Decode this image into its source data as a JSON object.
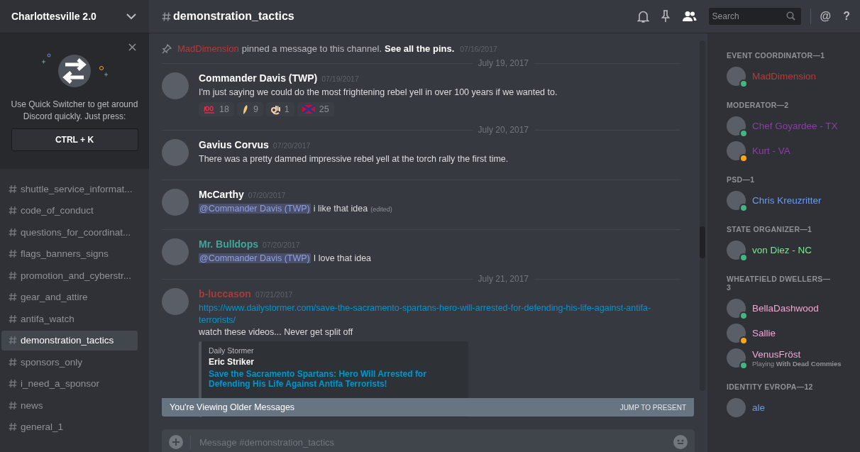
{
  "server": {
    "name": "Charlottesville 2.0"
  },
  "quick_switcher": {
    "text": "Use Quick Switcher to get around Discord quickly. Just press:",
    "shortcut": "CTRL + K"
  },
  "channels": [
    {
      "name": "shuttle_service_informat...",
      "selected": false
    },
    {
      "name": "code_of_conduct",
      "selected": false
    },
    {
      "name": "questions_for_coordinat...",
      "selected": false
    },
    {
      "name": "flags_banners_signs",
      "selected": false
    },
    {
      "name": "promotion_and_cyberstr...",
      "selected": false
    },
    {
      "name": "gear_and_attire",
      "selected": false
    },
    {
      "name": "antifa_watch",
      "selected": false
    },
    {
      "name": "demonstration_tactics",
      "selected": true
    },
    {
      "name": "sponsors_only",
      "selected": false
    },
    {
      "name": "i_need_a_sponsor",
      "selected": false
    },
    {
      "name": "news",
      "selected": false
    },
    {
      "name": "general_1",
      "selected": false
    }
  ],
  "header": {
    "channel": "demonstration_tactics",
    "search_placeholder": "Search",
    "mention_symbol": "@",
    "help_symbol": "?"
  },
  "pin_notice": {
    "author": "MadDimension",
    "color": "#b83a36",
    "text": "pinned a message to this channel.",
    "link": "See all the pins.",
    "time": "07/16/2017"
  },
  "messages": [
    {
      "date": "July 19, 2017",
      "author": "Commander Davis (TWP)",
      "color": "#ffffff",
      "time": "07/19/2017",
      "text": "I'm just saying we could do the most frightening rebel yell in over 100 years if we wanted to.",
      "reactions": [
        {
          "kind": "hundred",
          "count": "18"
        },
        {
          "kind": "crescent",
          "count": "9"
        },
        {
          "kind": "ok_hand",
          "count": "1"
        },
        {
          "kind": "flag",
          "count": "25"
        }
      ]
    },
    {
      "date": "July 20, 2017",
      "author": "Gavius Corvus",
      "color": "#ffffff",
      "time": "07/20/2017",
      "text": "There was a pretty damned impressive rebel yell at the torch rally the first time."
    },
    {
      "author": "McCarthy",
      "color": "#ffffff",
      "time": "07/20/2017",
      "mention": "@Commander Davis (TWP)",
      "text": "i like that idea",
      "edited": "(edited)"
    },
    {
      "author": "Mr. Bulldops",
      "color": "#3fa79a",
      "time": "07/20/2017",
      "mention": "@Commander Davis (TWP)",
      "text": "I love that idea"
    },
    {
      "date": "July 21, 2017",
      "author": "b-luccason",
      "color": "#a53c3c",
      "time": "07/21/2017",
      "link": "https://www.dailystormer.com/save-the-sacramento-spartans-hero-will-arrested-for-defending-his-life-against-antifa-terrorists/",
      "text": "watch these videos... Never get split off",
      "embed": {
        "provider": "Daily Stormer",
        "author": "Eric Striker",
        "title": "Save the Sacramento Spartans: Hero Will Arrested for Defending His Life Against Antifa Terrorists!"
      }
    }
  ],
  "older_bar": {
    "text": "You're Viewing Older Messages",
    "button": "JUMP TO PRESENT"
  },
  "composer": {
    "placeholder": "Message #demonstration_tactics"
  },
  "member_groups": [
    {
      "title": "EVENT COORDINATOR—1",
      "members": [
        {
          "name": "MadDimension",
          "color": "#b83a36",
          "status": {
            "color": "#43b581"
          }
        }
      ]
    },
    {
      "title": "MODERATOR—2",
      "members": [
        {
          "name": "Chef Goyardee - TX",
          "color": "#8a3fa3",
          "status": {
            "color": "#43b581"
          }
        },
        {
          "name": "Kurt - VA",
          "color": "#8a3fa3",
          "status": {
            "color": "#faa61a"
          }
        }
      ]
    },
    {
      "title": "PSD—1",
      "members": [
        {
          "name": "Chris Kreuzritter",
          "color": "#6a9cf0",
          "status": {
            "color": "#43b581"
          }
        }
      ]
    },
    {
      "title": "STATE ORGANIZER—1",
      "members": [
        {
          "name": "von Diez - NC",
          "color": "#7ce88f",
          "status": {
            "color": "#43b581"
          }
        }
      ]
    },
    {
      "title": "WHEATFIELD DWELLERS—3",
      "members": [
        {
          "name": "BellaDashwood",
          "color": "#f4a6d7",
          "status": {
            "color": "#43b581"
          }
        },
        {
          "name": "Sallie",
          "color": "#f4a6d7",
          "status": {
            "color": "#faa61a"
          }
        },
        {
          "name": "VenusFröst",
          "color": "#f4a6d7",
          "status": {
            "color": "#43b581"
          },
          "activity": "Playing **With Dead Commies**"
        }
      ]
    },
    {
      "title": "IDENTITY EVROPA—12",
      "members": [
        {
          "name": "ale",
          "color": "#6a9cf0"
        }
      ]
    }
  ]
}
